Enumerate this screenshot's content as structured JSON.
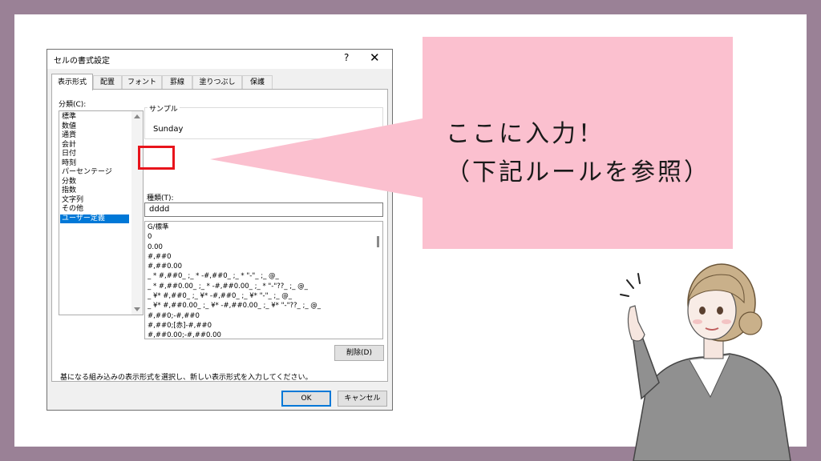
{
  "dialog": {
    "title": "セルの書式設定",
    "help_label": "?",
    "close_label": "✕",
    "tabs": [
      "表示形式",
      "配置",
      "フォント",
      "罫線",
      "塗りつぶし",
      "保護"
    ],
    "category_label": "分類(C):",
    "categories": [
      "標準",
      "数値",
      "通貨",
      "会計",
      "日付",
      "時刻",
      "パーセンテージ",
      "分数",
      "指数",
      "文字列",
      "その他",
      "ユーザー定義"
    ],
    "selected_category": "ユーザー定義",
    "sample_label": "サンプル",
    "sample_value": "Sunday",
    "type_label": "種類(T):",
    "type_value": "dddd",
    "formats": [
      "G/標準",
      "0",
      "0.00",
      "#,##0",
      "#,##0.00",
      "_ * #,##0_ ;_ * -#,##0_ ;_ * \"-\"_ ;_ @_",
      "_ * #,##0.00_ ;_ * -#,##0.00_ ;_ * \"-\"??_ ;_ @_",
      "_ ¥* #,##0_ ;_ ¥* -#,##0_ ;_ ¥* \"-\"_ ;_ @_",
      "_ ¥* #,##0.00_ ;_ ¥* -#,##0.00_ ;_ ¥* \"-\"??_ ;_ @_",
      "#,##0;-#,##0",
      "#,##0;[赤]-#,##0",
      "#,##0.00;-#,##0.00"
    ],
    "delete_button": "削除(D)",
    "description": "基になる組み込みの表示形式を選択し、新しい表示形式を入力してください。",
    "ok_button": "OK",
    "cancel_button": "キャンセル"
  },
  "callout": {
    "line1": "ここに入力！",
    "line2": "（下記ルールを参照）",
    "bubble_color": "#fbc0cf",
    "highlight_color": "#e8141c"
  },
  "colors": {
    "frame": "#9a8196",
    "selection": "#0078d7"
  }
}
